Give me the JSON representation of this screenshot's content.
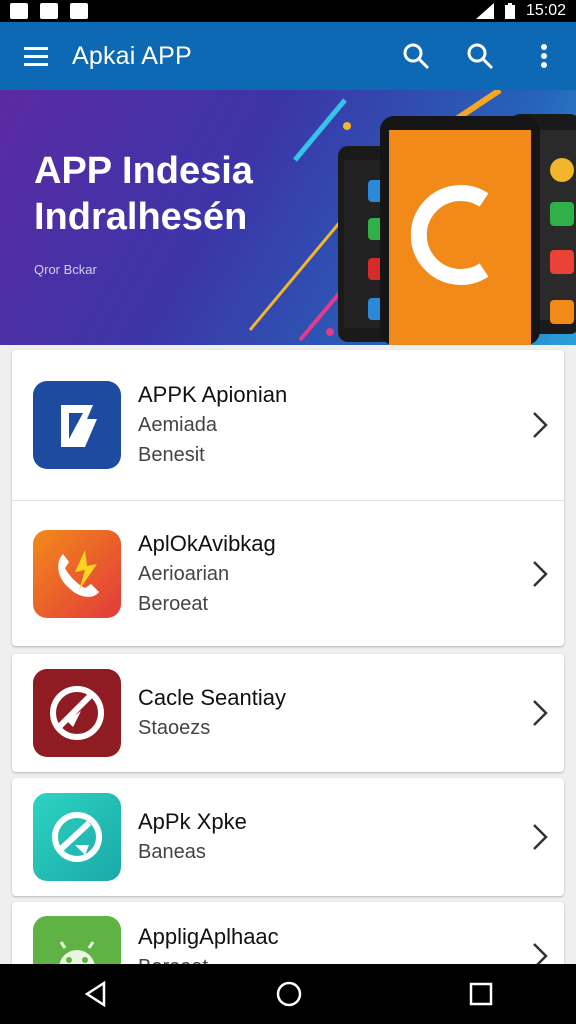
{
  "status": {
    "time": "15:02"
  },
  "appbar": {
    "title": "Apkai APP"
  },
  "banner": {
    "line1": "APP Indesia",
    "line2": "Indralhesén",
    "subtitle": "Qror Bckar"
  },
  "apps": [
    {
      "name": "APPK Apionian",
      "line2": "Aemiada",
      "line3": "Benesit",
      "icon": "blue-flag-icon"
    },
    {
      "name": "AplOkAvibkag",
      "line2": "Aerioarian",
      "line3": "Beroeat",
      "icon": "phone-flash-icon"
    },
    {
      "name": "Cacle Seantiay",
      "line2": "Staoezs",
      "line3": "",
      "icon": "red-no-icon"
    },
    {
      "name": "ApPk Xpke",
      "line2": "Baneas",
      "line3": "",
      "icon": "teal-circle-icon"
    },
    {
      "name": "AppligAplhaac",
      "line2": "Beroeat",
      "line3": "",
      "icon": "android-icon"
    }
  ],
  "colors": {
    "appbar": "#0d69b3",
    "accent_orange": "#f28a1a"
  }
}
